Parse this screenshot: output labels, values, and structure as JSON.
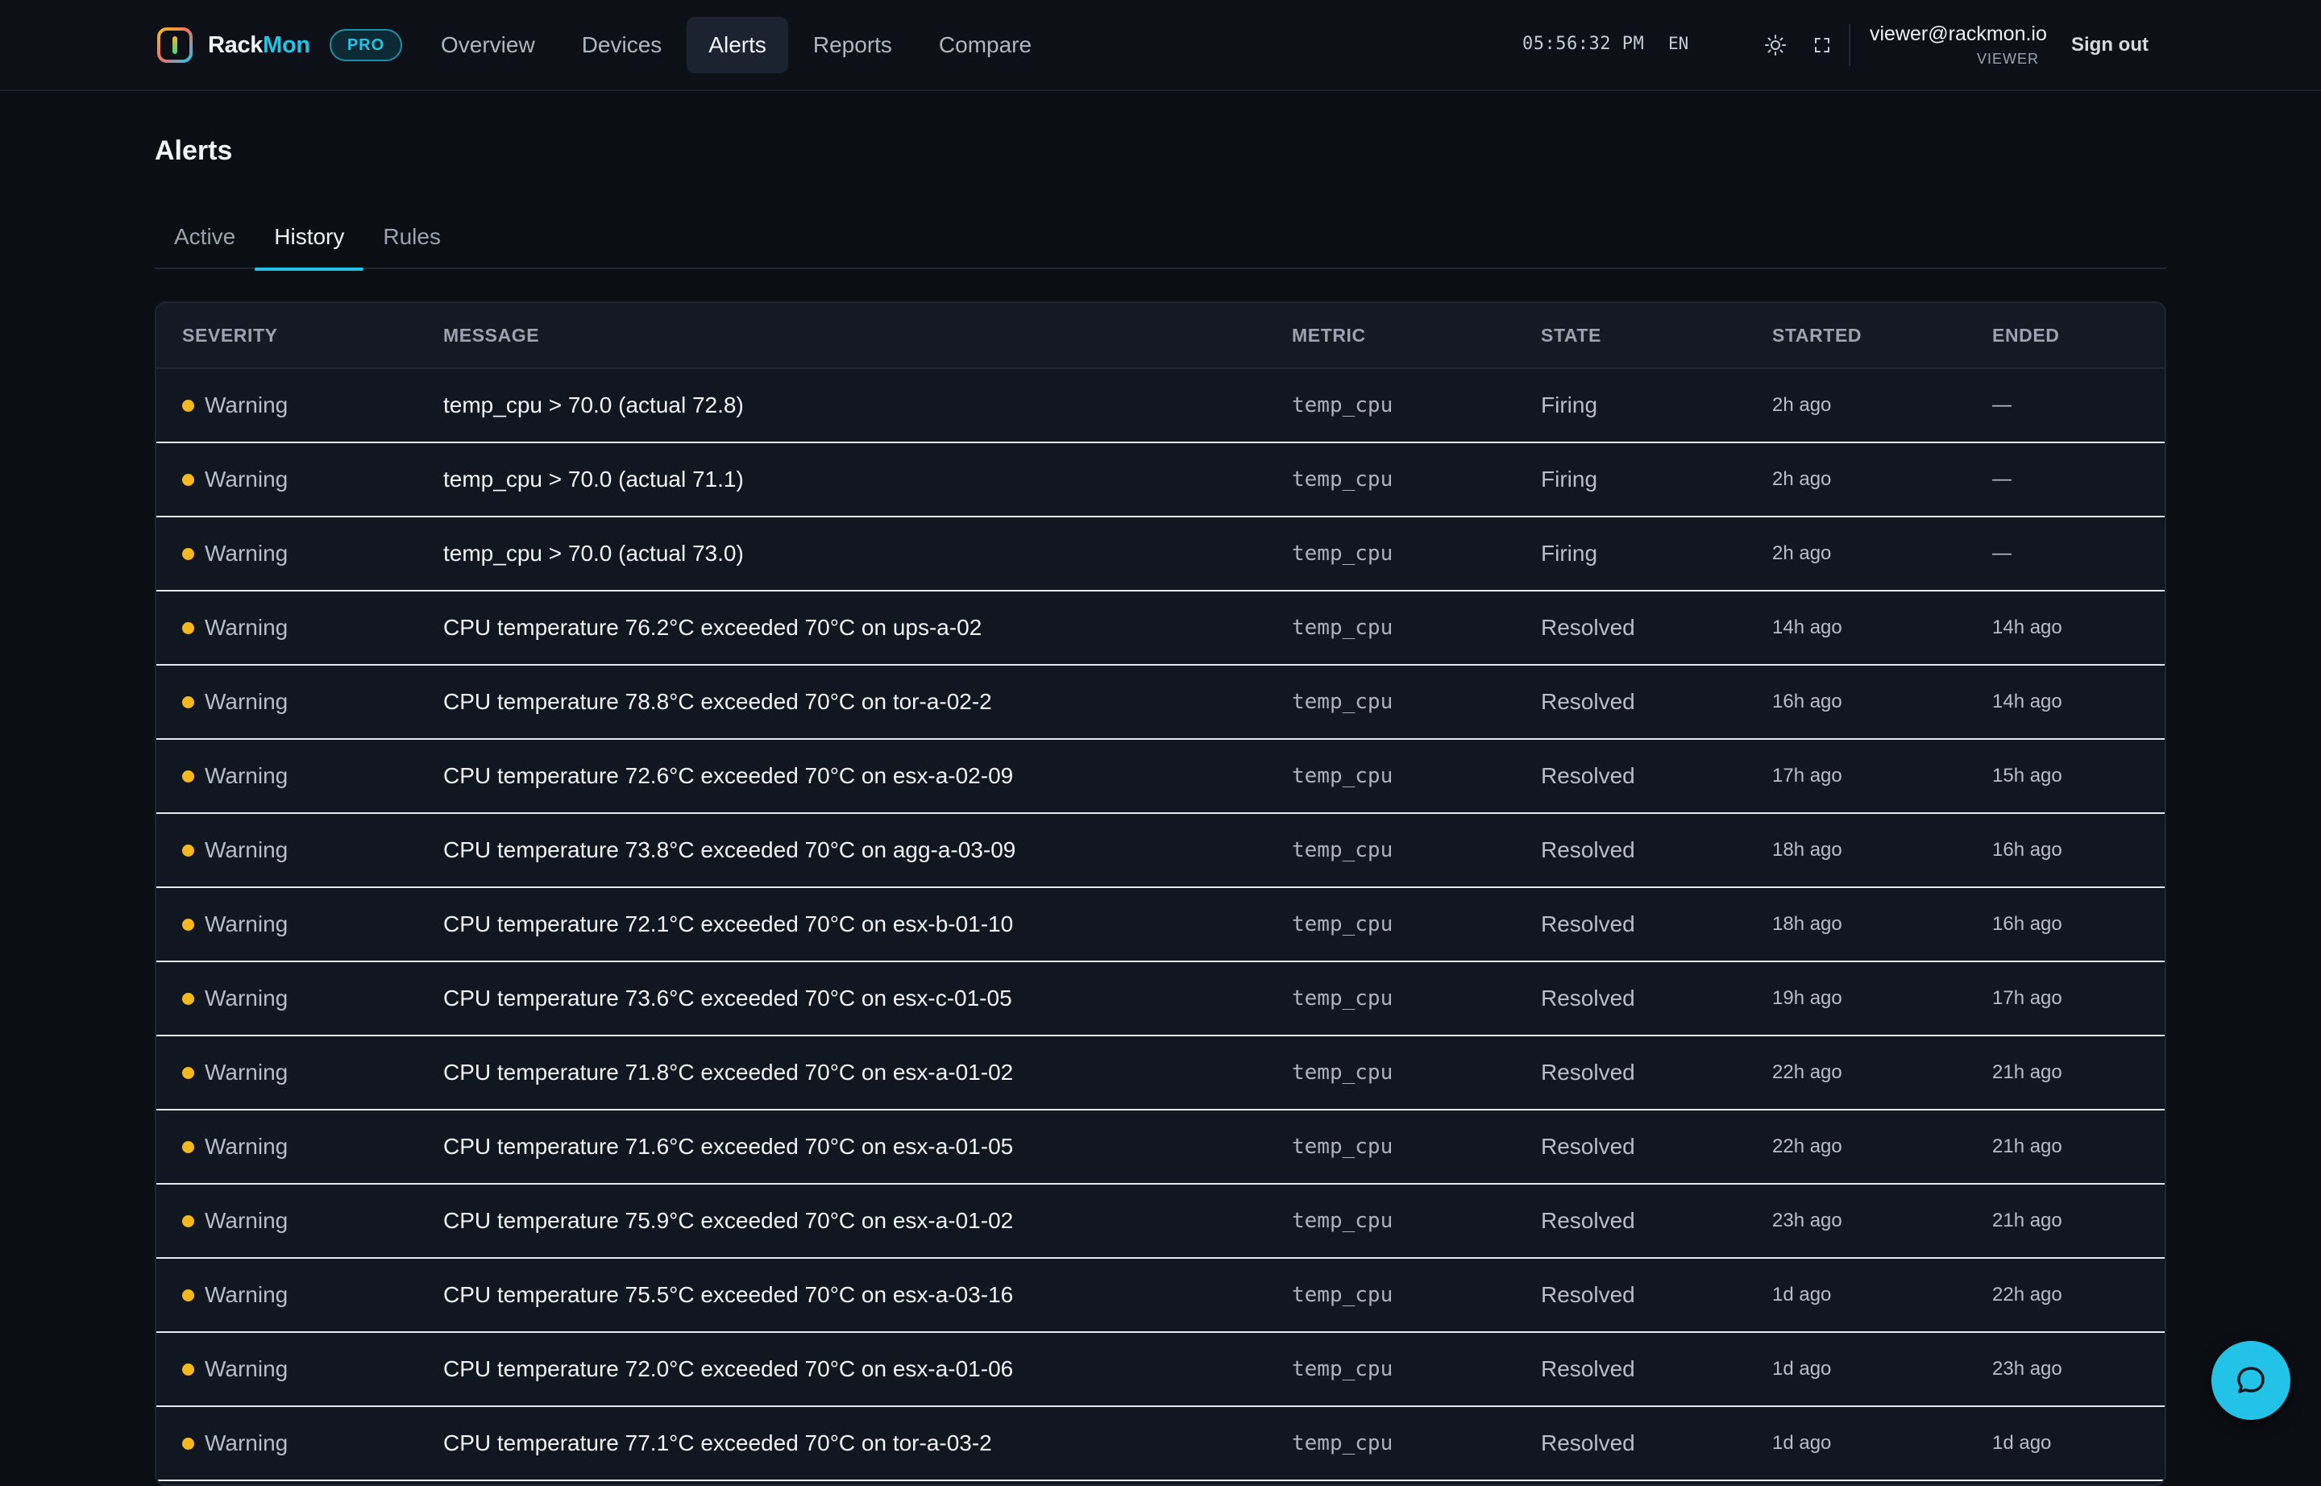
{
  "brand": {
    "name_part1": "Rack",
    "name_part2": "Mon",
    "badge": "PRO",
    "accent_color": "#22c3e6"
  },
  "nav": {
    "items": [
      {
        "label": "Overview",
        "active": false
      },
      {
        "label": "Devices",
        "active": false
      },
      {
        "label": "Alerts",
        "active": true
      },
      {
        "label": "Reports",
        "active": false
      },
      {
        "label": "Compare",
        "active": false
      }
    ]
  },
  "header": {
    "clock": "05:56:32 PM",
    "language": "EN",
    "theme_icon": "sun-icon",
    "fullscreen_icon": "fullscreen-icon",
    "user_email": "viewer@rackmon.io",
    "user_role": "VIEWER",
    "sign_out": "Sign out"
  },
  "page": {
    "title": "Alerts",
    "tabs": [
      {
        "label": "Active",
        "active": false
      },
      {
        "label": "History",
        "active": true
      },
      {
        "label": "Rules",
        "active": false
      }
    ]
  },
  "table": {
    "columns": {
      "severity": "SEVERITY",
      "message": "MESSAGE",
      "metric": "METRIC",
      "state": "STATE",
      "started": "STARTED",
      "ended": "ENDED"
    },
    "warning_color": "#f5b91f",
    "rows": [
      {
        "severity": "Warning",
        "message": "temp_cpu > 70.0 (actual 72.8)",
        "metric": "temp_cpu",
        "state": "Firing",
        "started": "2h ago",
        "ended": "—"
      },
      {
        "severity": "Warning",
        "message": "temp_cpu > 70.0 (actual 71.1)",
        "metric": "temp_cpu",
        "state": "Firing",
        "started": "2h ago",
        "ended": "—"
      },
      {
        "severity": "Warning",
        "message": "temp_cpu > 70.0 (actual 73.0)",
        "metric": "temp_cpu",
        "state": "Firing",
        "started": "2h ago",
        "ended": "—"
      },
      {
        "severity": "Warning",
        "message": "CPU temperature 76.2°C exceeded 70°C on ups-a-02",
        "metric": "temp_cpu",
        "state": "Resolved",
        "started": "14h ago",
        "ended": "14h ago"
      },
      {
        "severity": "Warning",
        "message": "CPU temperature 78.8°C exceeded 70°C on tor-a-02-2",
        "metric": "temp_cpu",
        "state": "Resolved",
        "started": "16h ago",
        "ended": "14h ago"
      },
      {
        "severity": "Warning",
        "message": "CPU temperature 72.6°C exceeded 70°C on esx-a-02-09",
        "metric": "temp_cpu",
        "state": "Resolved",
        "started": "17h ago",
        "ended": "15h ago"
      },
      {
        "severity": "Warning",
        "message": "CPU temperature 73.8°C exceeded 70°C on agg-a-03-09",
        "metric": "temp_cpu",
        "state": "Resolved",
        "started": "18h ago",
        "ended": "16h ago"
      },
      {
        "severity": "Warning",
        "message": "CPU temperature 72.1°C exceeded 70°C on esx-b-01-10",
        "metric": "temp_cpu",
        "state": "Resolved",
        "started": "18h ago",
        "ended": "16h ago"
      },
      {
        "severity": "Warning",
        "message": "CPU temperature 73.6°C exceeded 70°C on esx-c-01-05",
        "metric": "temp_cpu",
        "state": "Resolved",
        "started": "19h ago",
        "ended": "17h ago"
      },
      {
        "severity": "Warning",
        "message": "CPU temperature 71.8°C exceeded 70°C on esx-a-01-02",
        "metric": "temp_cpu",
        "state": "Resolved",
        "started": "22h ago",
        "ended": "21h ago"
      },
      {
        "severity": "Warning",
        "message": "CPU temperature 71.6°C exceeded 70°C on esx-a-01-05",
        "metric": "temp_cpu",
        "state": "Resolved",
        "started": "22h ago",
        "ended": "21h ago"
      },
      {
        "severity": "Warning",
        "message": "CPU temperature 75.9°C exceeded 70°C on esx-a-01-02",
        "metric": "temp_cpu",
        "state": "Resolved",
        "started": "23h ago",
        "ended": "21h ago"
      },
      {
        "severity": "Warning",
        "message": "CPU temperature 75.5°C exceeded 70°C on esx-a-03-16",
        "metric": "temp_cpu",
        "state": "Resolved",
        "started": "1d ago",
        "ended": "22h ago"
      },
      {
        "severity": "Warning",
        "message": "CPU temperature 72.0°C exceeded 70°C on esx-a-01-06",
        "metric": "temp_cpu",
        "state": "Resolved",
        "started": "1d ago",
        "ended": "23h ago"
      },
      {
        "severity": "Warning",
        "message": "CPU temperature 77.1°C exceeded 70°C on tor-a-03-2",
        "metric": "temp_cpu",
        "state": "Resolved",
        "started": "1d ago",
        "ended": "1d ago"
      }
    ]
  },
  "chat": {
    "icon": "chat-bubble-icon"
  }
}
